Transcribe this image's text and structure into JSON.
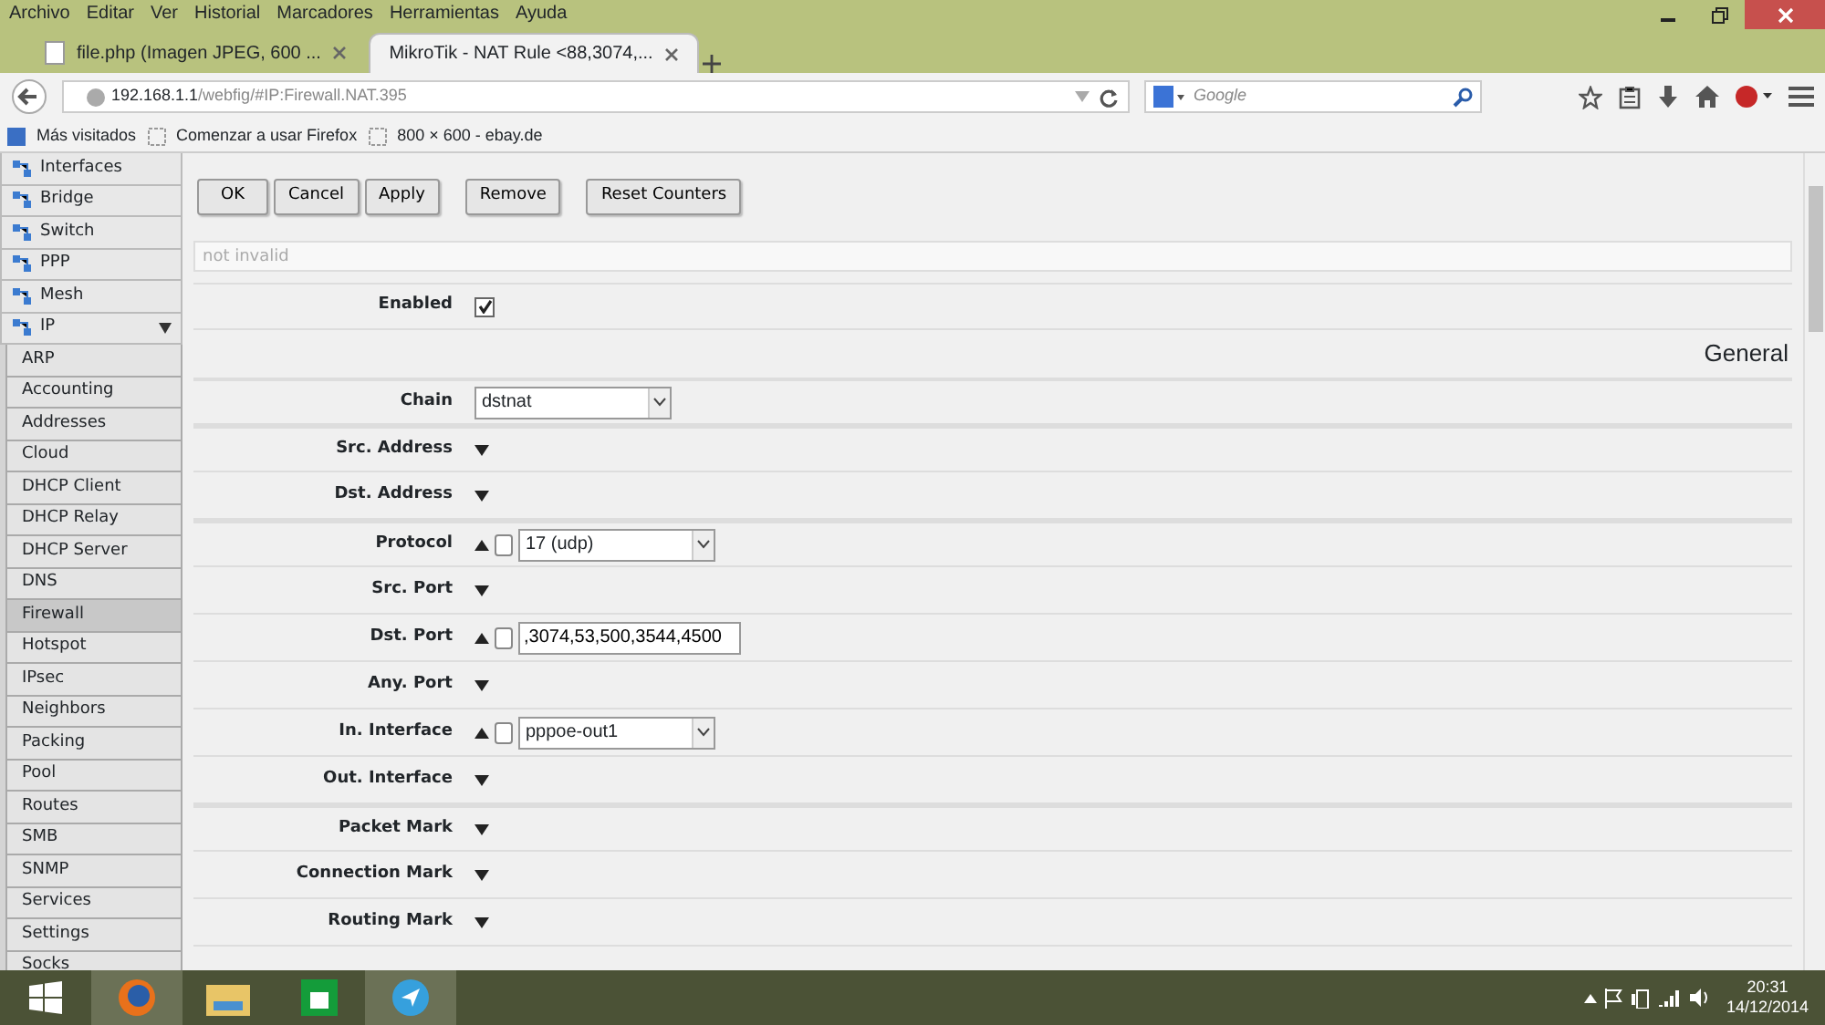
{
  "menu_bar": [
    "Archivo",
    "Editar",
    "Ver",
    "Historial",
    "Marcadores",
    "Herramientas",
    "Ayuda"
  ],
  "tabs": [
    {
      "label": "file.php (Imagen JPEG, 600 ...",
      "selected": false
    },
    {
      "label": "MikroTik - NAT Rule <88,3074,...",
      "selected": true
    }
  ],
  "address_bar": {
    "host": "192.168.1.1",
    "path": "/webfig/#IP:Firewall.NAT.395"
  },
  "search": {
    "placeholder": "Google"
  },
  "bookmarks": [
    "Más visitados",
    "Comenzar a usar Firefox",
    "800 × 600 - ebay.de"
  ],
  "sidebar": {
    "items": [
      {
        "label": "Interfaces",
        "expanded": false
      },
      {
        "label": "Bridge",
        "expanded": false
      },
      {
        "label": "Switch",
        "expanded": false
      },
      {
        "label": "PPP",
        "expanded": false
      },
      {
        "label": "Mesh",
        "expanded": false
      },
      {
        "label": "IP",
        "expanded": true,
        "children": [
          {
            "label": "ARP",
            "selected": false
          },
          {
            "label": "Accounting",
            "selected": false
          },
          {
            "label": "Addresses",
            "selected": false
          },
          {
            "label": "Cloud",
            "selected": false
          },
          {
            "label": "DHCP Client",
            "selected": false
          },
          {
            "label": "DHCP Relay",
            "selected": false
          },
          {
            "label": "DHCP Server",
            "selected": false
          },
          {
            "label": "DNS",
            "selected": false
          },
          {
            "label": "Firewall",
            "selected": true
          },
          {
            "label": "Hotspot",
            "selected": false
          },
          {
            "label": "IPsec",
            "selected": false
          },
          {
            "label": "Neighbors",
            "selected": false
          },
          {
            "label": "Packing",
            "selected": false
          },
          {
            "label": "Pool",
            "selected": false
          },
          {
            "label": "Routes",
            "selected": false
          },
          {
            "label": "SMB",
            "selected": false
          },
          {
            "label": "SNMP",
            "selected": false
          },
          {
            "label": "Services",
            "selected": false
          },
          {
            "label": "Settings",
            "selected": false
          },
          {
            "label": "Socks",
            "selected": false
          }
        ]
      }
    ]
  },
  "buttons": [
    "OK",
    "Cancel",
    "Apply",
    "Remove",
    "Reset Counters"
  ],
  "status_field": {
    "placeholder": "not invalid"
  },
  "enabled": {
    "label": "Enabled",
    "checked": true
  },
  "section_title": "General",
  "field_groups": [
    [
      {
        "label": "Chain",
        "kind": "select",
        "value": "dstnat"
      }
    ],
    [
      {
        "label": "Src. Address",
        "kind": "collapsed"
      },
      {
        "label": "Dst. Address",
        "kind": "collapsed"
      }
    ],
    [
      {
        "label": "Protocol",
        "kind": "select-negatable",
        "negated": false,
        "value": "17 (udp)"
      },
      {
        "label": "Src. Port",
        "kind": "collapsed"
      },
      {
        "label": "Dst. Port",
        "kind": "input-negatable",
        "negated": false,
        "value": ",3074,53,500,3544,4500"
      },
      {
        "label": "Any. Port",
        "kind": "collapsed"
      },
      {
        "label": "In. Interface",
        "kind": "select-negatable",
        "negated": false,
        "value": "pppoe-out1"
      },
      {
        "label": "Out. Interface",
        "kind": "collapsed"
      }
    ],
    [
      {
        "label": "Packet Mark",
        "kind": "collapsed"
      },
      {
        "label": "Connection Mark",
        "kind": "collapsed"
      },
      {
        "label": "Routing Mark",
        "kind": "collapsed"
      }
    ]
  ],
  "clock": {
    "time": "20:31",
    "date": "14/12/2014"
  }
}
